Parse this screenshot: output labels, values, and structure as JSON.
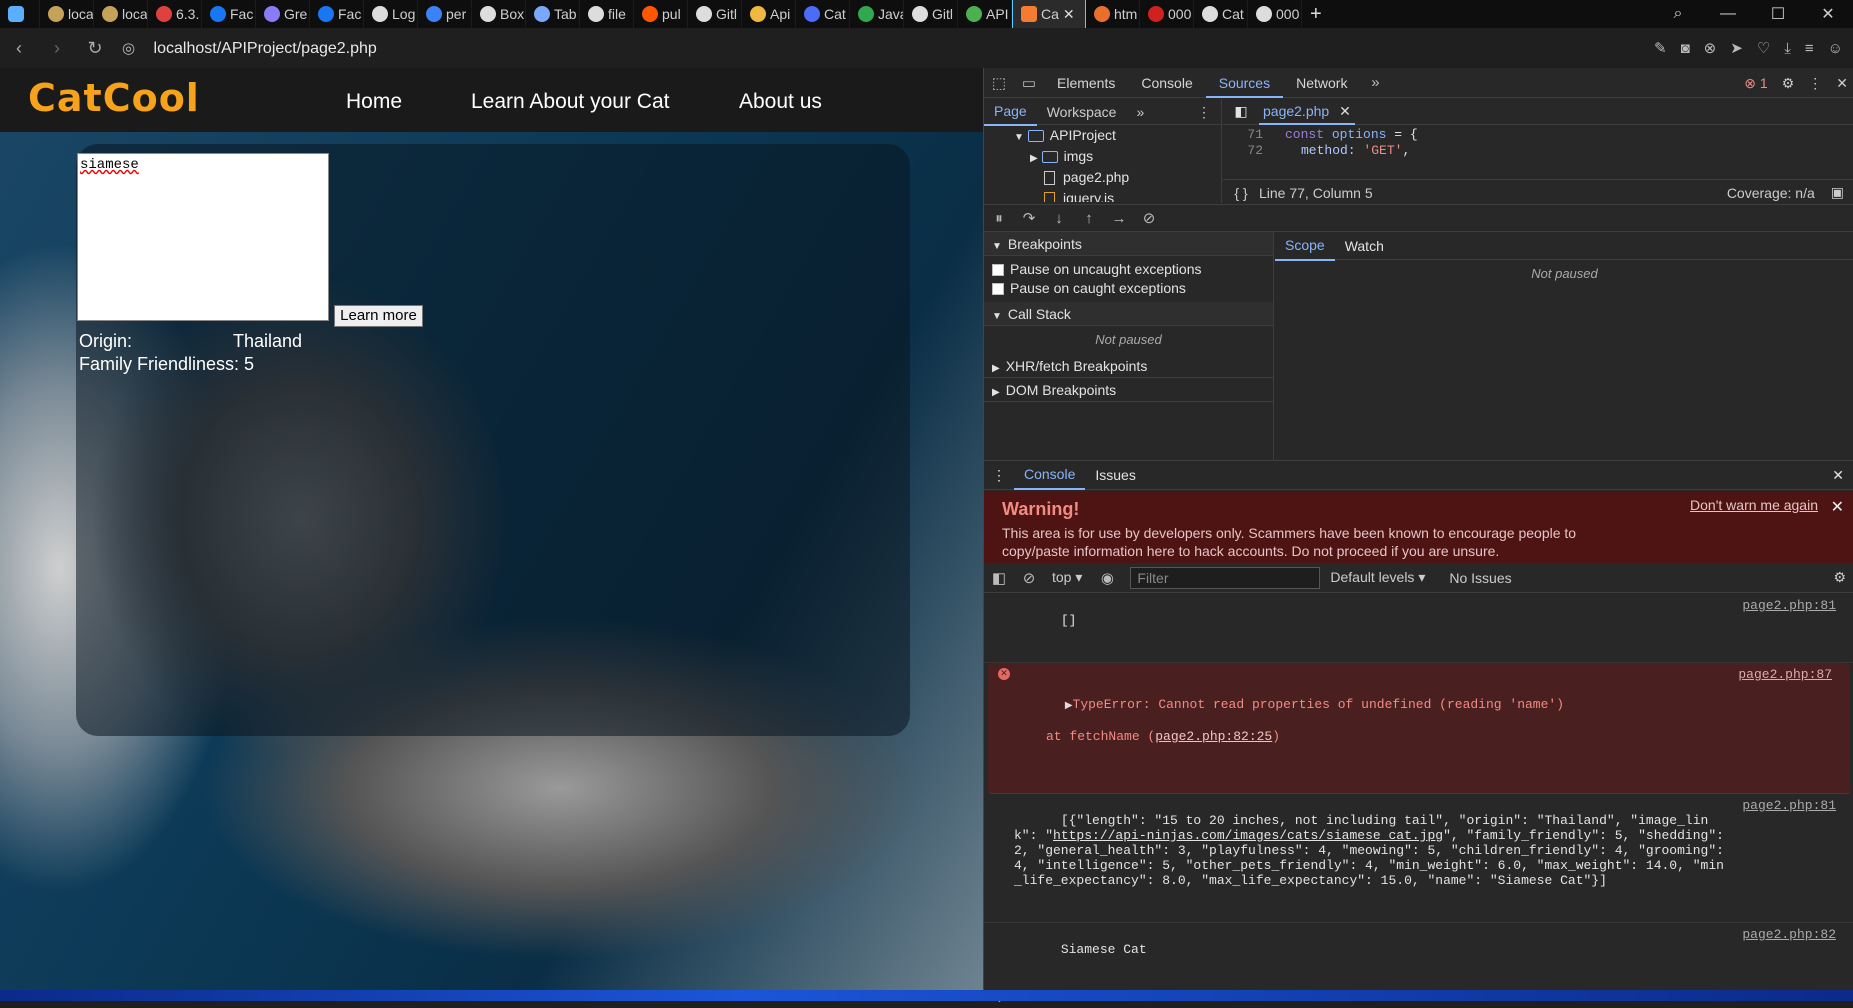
{
  "browser": {
    "tabs": [
      {
        "label": "loca",
        "color": "#c5a25a"
      },
      {
        "label": "loca",
        "color": "#c5a25a"
      },
      {
        "label": "6.3.",
        "color": "#e04040"
      },
      {
        "label": "Fac",
        "color": "#1877f2"
      },
      {
        "label": "Gre",
        "color": "#8a7cf8"
      },
      {
        "label": "Fac",
        "color": "#1877f2"
      },
      {
        "label": "Log",
        "color": "#dddddd"
      },
      {
        "label": "per",
        "color": "#3b82f6"
      },
      {
        "label": "Box",
        "color": "#dddddd"
      },
      {
        "label": "Tab",
        "color": "#7aa7ff"
      },
      {
        "label": "file",
        "color": "#dddddd"
      },
      {
        "label": "pul",
        "color": "#ff5700"
      },
      {
        "label": "Gitl",
        "color": "#dddddd"
      },
      {
        "label": "Api",
        "color": "#f0b840"
      },
      {
        "label": "Cat",
        "color": "#4a6cf7"
      },
      {
        "label": "Java",
        "color": "#2fa84f"
      },
      {
        "label": "Gitl",
        "color": "#dddddd"
      },
      {
        "label": "API",
        "color": "#4caf50"
      }
    ],
    "active_tab": {
      "label": "Ca",
      "color": "#f47c30"
    },
    "tabs_after": [
      {
        "label": "htm",
        "color": "#e8702a"
      },
      {
        "label": "000",
        "color": "#d02020"
      },
      {
        "label": "Cat",
        "color": "#dddddd"
      },
      {
        "label": "000",
        "color": "#dddddd"
      }
    ],
    "new_tab": "+",
    "url": "localhost/APIProject/page2.php"
  },
  "site": {
    "logo": "CatCool",
    "nav": [
      "Home",
      "Learn About your Cat",
      "About us"
    ],
    "input_value": "siamese",
    "button_label": "Learn more",
    "origin_label": "Origin:",
    "origin_value": "Thailand",
    "family_label": "Family Friendliness: 5"
  },
  "devtools": {
    "tabs": [
      "Elements",
      "Console",
      "Sources",
      "Network"
    ],
    "active_tab": "Sources",
    "error_count": "1",
    "sources": {
      "subtabs": [
        "Page",
        "Workspace"
      ],
      "tree": {
        "root": "APIProject",
        "items": [
          "imgs",
          "page2.php",
          "jquery.js"
        ]
      },
      "open_file": "page2.php",
      "code": [
        {
          "line": "71",
          "kw": "const",
          "name": "options",
          "rest": " = {"
        },
        {
          "line": "72",
          "prop": "method:",
          "str": "'GET'",
          "rest": ","
        }
      ],
      "status_position": "Line 77, Column 5",
      "coverage": "Coverage: n/a"
    },
    "debugger": {
      "breakpoints_title": "Breakpoints",
      "pause_uncaught": "Pause on uncaught exceptions",
      "pause_caught": "Pause on caught exceptions",
      "call_stack_title": "Call Stack",
      "not_paused": "Not paused",
      "xhr_title": "XHR/fetch Breakpoints",
      "dom_title": "DOM Breakpoints",
      "scope_tabs": [
        "Scope",
        "Watch"
      ]
    },
    "drawer": {
      "tabs": [
        "Console",
        "Issues"
      ],
      "warning_title": "Warning!",
      "warning_body": "This area is for use by developers only. Scammers have been known to encourage people to copy/paste information here to hack accounts. Do not proceed if you are unsure.",
      "dont_warn": "Don't warn me again",
      "context": "top",
      "filter_placeholder": "Filter",
      "levels": "Default levels",
      "issues": "No Issues"
    },
    "console": [
      {
        "text": "[]",
        "source": "page2.php:81"
      },
      {
        "text": "TypeError: Cannot read properties of undefined (reading 'name')",
        "at_prefix": "at fetchName (",
        "at_link": "page2.php:82:25",
        "at_suffix": ")",
        "source": "page2.php:87"
      },
      {
        "text_before_link": "[{\"length\": \"15 to 20 inches, not including tail\", \"origin\": \"Thailand\", \"image_link\": \"",
        "link": "https://api-ninjas.com/images/cats/siamese_cat.jpg",
        "text_after_link": "\", \"family_friendly\": 5, \"shedding\": 2, \"general_health\": 3, \"playfulness\": 4, \"meowing\": 5, \"children_friendly\": 4, \"grooming\": 4, \"intelligence\": 5, \"other_pets_friendly\": 4, \"min_weight\": 6.0, \"max_weight\": 14.0, \"min_life_expectancy\": 8.0, \"max_life_expectancy\": 15.0, \"name\": \"Siamese Cat\"}]",
        "source": "page2.php:81"
      },
      {
        "text": "Siamese Cat",
        "source": "page2.php:82"
      }
    ]
  }
}
